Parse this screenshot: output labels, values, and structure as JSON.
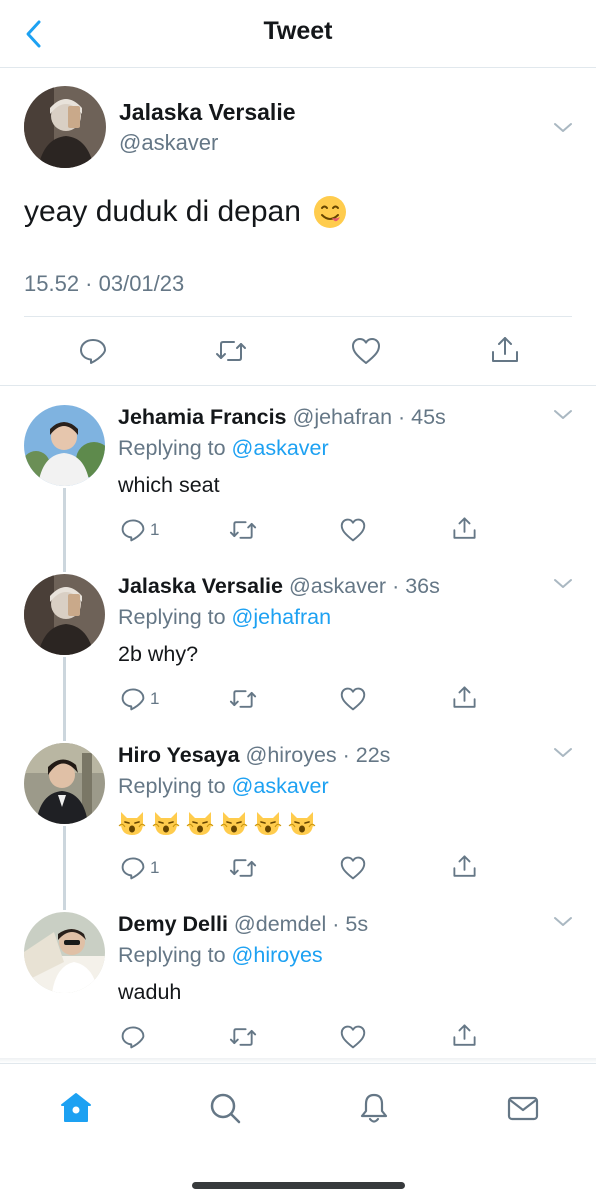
{
  "header": {
    "title": "Tweet"
  },
  "main_tweet": {
    "name": "Jalaska Versalie",
    "handle": "@askaver",
    "text": "yeay duduk di depan",
    "emoji": "smiling-face-savoring-food",
    "timestamp": "15.52 · 03/01/23"
  },
  "replies": [
    {
      "name": "Jehamia Francis",
      "meta": "@jehafran · 45s",
      "replying_prefix": "Replying to ",
      "replying_to": "@askaver",
      "text": "which seat",
      "reply_count": "1"
    },
    {
      "name": "Jalaska Versalie",
      "meta": "@askaver · 36s",
      "replying_prefix": "Replying to ",
      "replying_to": "@jehafran",
      "text": "2b why?",
      "reply_count": "1"
    },
    {
      "name": "Hiro Yesaya",
      "meta": "@hiroyes · 22s",
      "replying_prefix": "Replying to ",
      "replying_to": "@askaver",
      "text_emojis": [
        "weary-cat",
        "weary-cat",
        "weary-cat",
        "weary-cat",
        "weary-cat",
        "weary-cat"
      ],
      "reply_count": "1"
    },
    {
      "name": "Demy Delli",
      "meta": "@demdel · 5s",
      "replying_prefix": "Replying to ",
      "replying_to": "@hiroyes",
      "text": "waduh",
      "reply_count": ""
    }
  ],
  "colors": {
    "accent": "#1da1f2",
    "muted": "#657786",
    "text": "#14171a",
    "border": "#e1e8ed"
  }
}
